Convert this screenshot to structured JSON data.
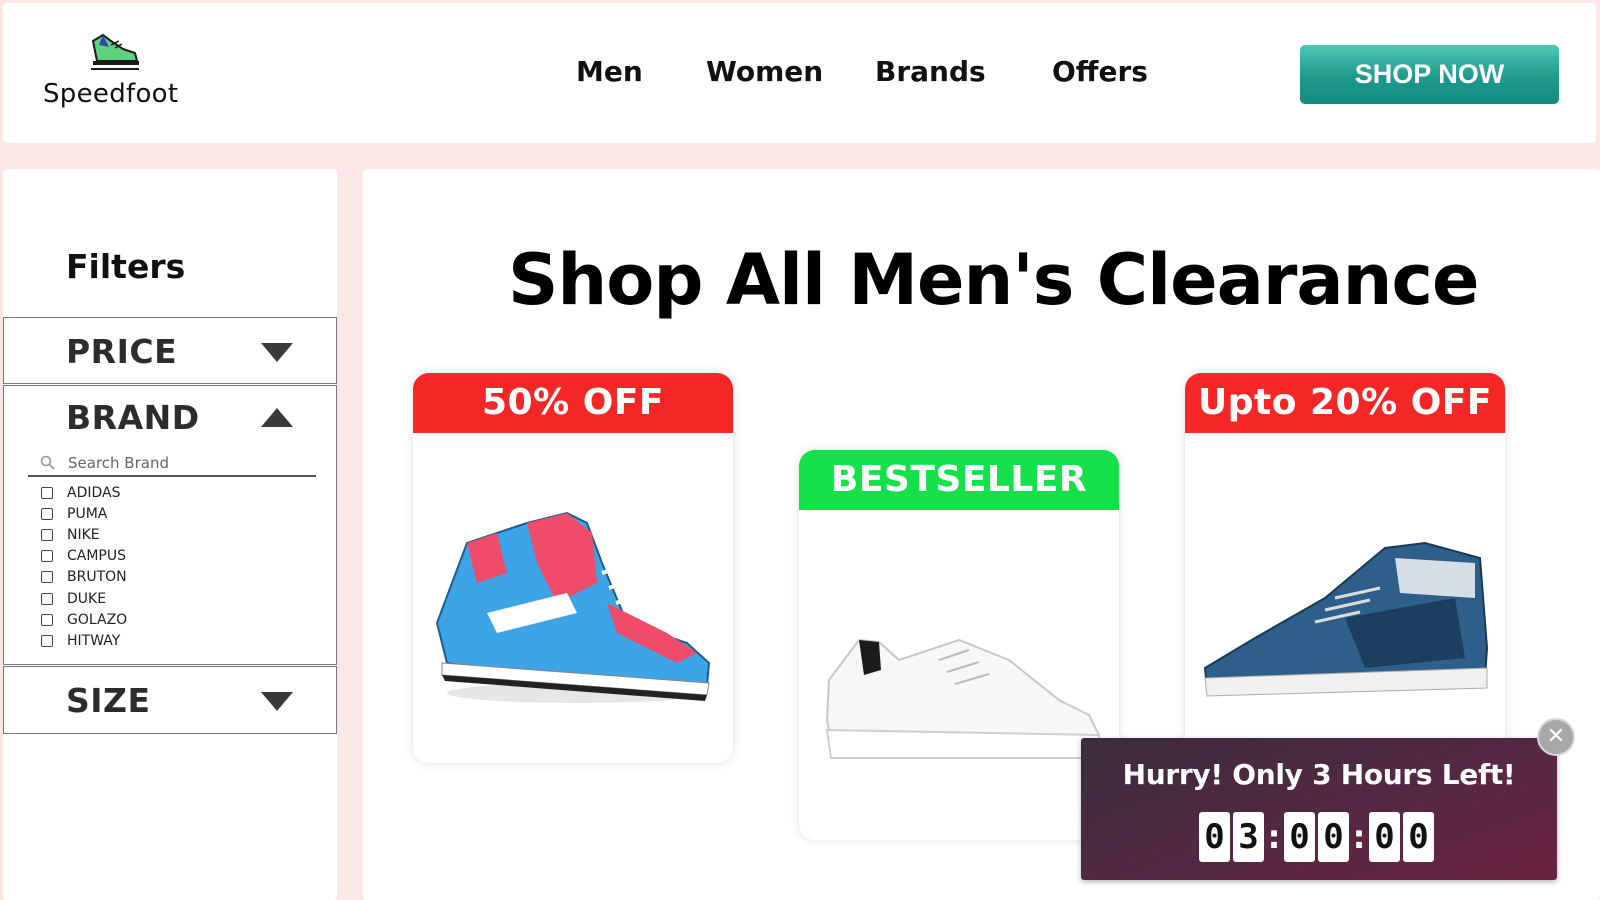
{
  "brand": {
    "name": "Speedfoot"
  },
  "nav": {
    "items": [
      "Men",
      "Women",
      "Brands",
      "Offers"
    ],
    "cta": "SHOP NOW"
  },
  "colors": {
    "accent": "#1e9a8c",
    "offer_red": "#f52626",
    "bestseller_green": "#14e04a",
    "timer_bg": "#552844"
  },
  "sidebar": {
    "title": "Filters",
    "price_label": "PRICE",
    "brand_label": "BRAND",
    "size_label": "SIZE",
    "search_placeholder": "Search Brand",
    "brands": [
      "ADIDAS",
      "PUMA",
      "NIKE",
      "CAMPUS",
      "BRUTON",
      "DUKE",
      "GOLAZO",
      "HITWAY"
    ]
  },
  "main": {
    "title": "Shop All Men's Clearance",
    "cards": [
      {
        "badge": "50% OFF"
      },
      {
        "badge": "BESTSELLER"
      },
      {
        "badge": "Upto 20% OFF"
      }
    ]
  },
  "timer": {
    "text": "Hurry! Only 3 Hours Left!",
    "digits": [
      "0",
      "3",
      "0",
      "0",
      "0",
      "0"
    ],
    "close": "✕"
  }
}
